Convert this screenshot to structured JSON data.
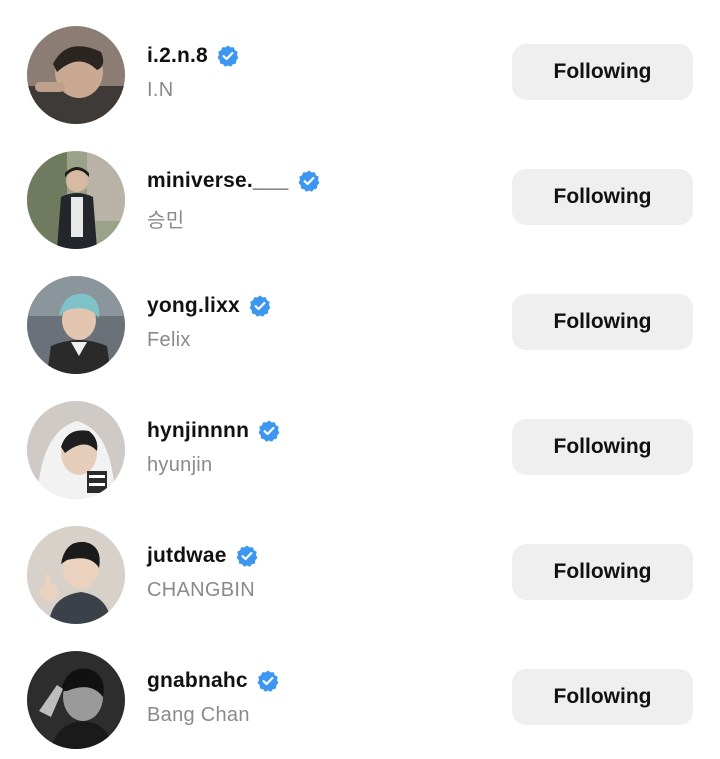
{
  "accounts": [
    {
      "username": "i.2.n.8",
      "name": "I.N",
      "verified": true,
      "button": "Following",
      "avatar_tone": "#6e6058"
    },
    {
      "username": "miniverse.___",
      "name": "승민",
      "verified": true,
      "button": "Following",
      "avatar_tone": "#7d8a6a"
    },
    {
      "username": "yong.lixx",
      "name": "Felix",
      "verified": true,
      "button": "Following",
      "avatar_tone": "#5b6470"
    },
    {
      "username": "hynjinnnn",
      "name": "hyunjin",
      "verified": true,
      "button": "Following",
      "avatar_tone": "#c9c4bf"
    },
    {
      "username": "jutdwae",
      "name": "CHANGBIN",
      "verified": true,
      "button": "Following",
      "avatar_tone": "#bfb6ac"
    },
    {
      "username": "gnabnahc",
      "name": "Bang Chan",
      "verified": true,
      "button": "Following",
      "avatar_tone": "#3a3a3a"
    }
  ],
  "colors": {
    "verified_badge": "#3d97f0",
    "button_bg": "#efefef",
    "secondary_text": "#8a8a8a"
  },
  "icons": {
    "verified": "verified-badge-icon"
  }
}
